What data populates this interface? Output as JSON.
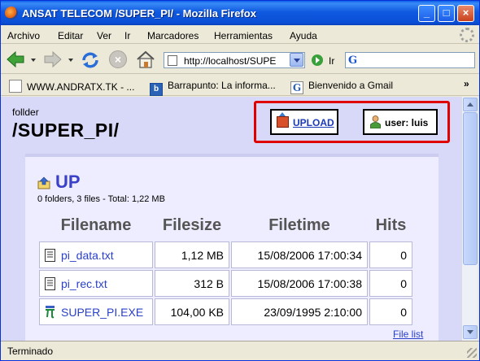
{
  "window": {
    "title": "ANSAT TELECOM /SUPER_PI/ - Mozilla Firefox",
    "minimize": "_",
    "maximize": "□",
    "close": "×"
  },
  "menu": [
    "Archivo",
    "Editar",
    "Ver",
    "Ir",
    "Marcadores",
    "Herramientas",
    "Ayuda"
  ],
  "navbar": {
    "url": "http://localhost/SUPE",
    "go_label": "Ir",
    "search_engine": "G"
  },
  "bookmarks": {
    "items": [
      "WWW.ANDRATX.TK - ...",
      "Barrapunto: La informa...",
      "Bienvenido a Gmail"
    ],
    "more": "»",
    "icon2_letter": "b",
    "icon3_letter": "G"
  },
  "page": {
    "folder_label": "follder",
    "folder_name": "/SUPER_PI/",
    "upload_label": "UPLOAD",
    "user_label": "user: luis",
    "up_label": "UP",
    "summary": "0 folders, 3 files - Total: 1,22 MB",
    "file_list_link": "File list",
    "headers": [
      "Filename",
      "Filesize",
      "Filetime",
      "Hits"
    ],
    "files": [
      {
        "name": "pi_data.txt",
        "size": "1,12 MB",
        "time": "15/08/2006 17:00:34",
        "hits": "0",
        "icon": "text-file-icon"
      },
      {
        "name": "pi_rec.txt",
        "size": "312 B",
        "time": "15/08/2006 17:00:38",
        "hits": "0",
        "icon": "text-file-icon"
      },
      {
        "name": "SUPER_PI.EXE",
        "size": "104,00 KB",
        "time": "23/09/1995 2:10:00",
        "hits": "0",
        "icon": "exe-pi-icon"
      }
    ]
  },
  "status": {
    "text": "Terminado"
  },
  "colors": {
    "highlight": "#e00000",
    "link": "#2a40c8",
    "page_bg": "#d8d8f8"
  }
}
